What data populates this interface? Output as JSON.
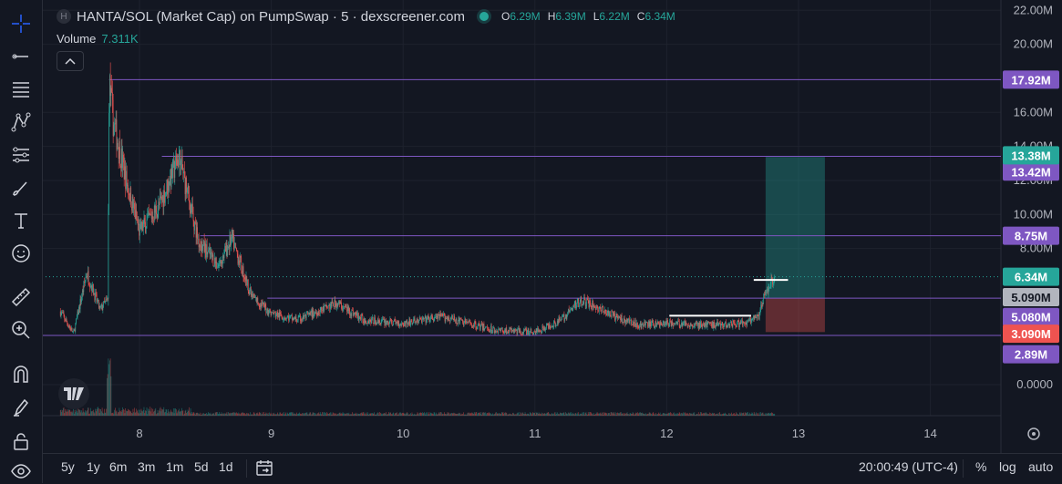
{
  "header": {
    "symbol_badge": "H",
    "title": "HANTA/SOL (Market Cap) on PumpSwap · 5 · dexscreener.com",
    "ohlc": [
      {
        "key": "O",
        "value": "6.29M"
      },
      {
        "key": "H",
        "value": "6.39M"
      },
      {
        "key": "L",
        "value": "6.22M"
      },
      {
        "key": "C",
        "value": "6.34M"
      }
    ]
  },
  "volume": {
    "label": "Volume",
    "value": "7.311K"
  },
  "toolbar": {
    "icons": [
      "crosshair-icon",
      "trend-line-icon",
      "fib-levels-icon",
      "pattern-icon",
      "projection-icon",
      "brush-icon",
      "text-icon",
      "emoji-icon",
      "ruler-icon",
      "zoom-in-icon",
      "magnet-icon",
      "lock-pencil-icon",
      "lock-icon",
      "eye-icon"
    ]
  },
  "bottom": {
    "ranges": [
      "5y",
      "1y",
      "6m",
      "3m",
      "1m",
      "5d",
      "1d"
    ],
    "time": "20:00:49 (UTC-4)",
    "percent": "%",
    "log": "log",
    "auto": "auto"
  },
  "colors": {
    "background": "#131722",
    "up": "#26a69a",
    "down": "#ef5350",
    "line": "#7e57c2",
    "level_label": "#7e57c2",
    "current_price": "#26a69a"
  },
  "chart_data": {
    "type": "candlestick",
    "title": "HANTA/SOL (Market Cap) on PumpSwap · 5 · dexscreener.com",
    "y_axis_ticks": [
      "22.00M",
      "20.00M",
      "16.00M",
      "14.00M",
      "12.00M",
      "10.00M",
      "8.00M",
      "0.0000"
    ],
    "y_tick_values": [
      22,
      20,
      16,
      14,
      12,
      10,
      8,
      0
    ],
    "x_axis_ticks": [
      "8",
      "9",
      "10",
      "11",
      "12",
      "13",
      "14"
    ],
    "x_tick_values": [
      8,
      9,
      10,
      11,
      12,
      13,
      14
    ],
    "price_path": [
      [
        7.4,
        4.3
      ],
      [
        7.5,
        3.0
      ],
      [
        7.6,
        6.6
      ],
      [
        7.7,
        4.4
      ],
      [
        7.76,
        5.0
      ],
      [
        7.77,
        17.9
      ],
      [
        7.8,
        15.5
      ],
      [
        7.9,
        12.0
      ],
      [
        8.0,
        9.0
      ],
      [
        8.15,
        10.5
      ],
      [
        8.3,
        13.4
      ],
      [
        8.45,
        8.4
      ],
      [
        8.6,
        7.0
      ],
      [
        8.7,
        8.6
      ],
      [
        8.85,
        5.2
      ],
      [
        9.0,
        4.2
      ],
      [
        9.2,
        3.8
      ],
      [
        9.5,
        4.8
      ],
      [
        9.7,
        3.8
      ],
      [
        10.0,
        3.6
      ],
      [
        10.3,
        4.0
      ],
      [
        10.7,
        3.2
      ],
      [
        11.0,
        3.1
      ],
      [
        11.2,
        3.8
      ],
      [
        11.35,
        5.0
      ],
      [
        11.6,
        4.0
      ],
      [
        11.8,
        3.5
      ],
      [
        12.0,
        3.6
      ],
      [
        12.3,
        3.5
      ],
      [
        12.6,
        3.6
      ],
      [
        12.7,
        4.0
      ],
      [
        12.75,
        5.5
      ],
      [
        12.82,
        6.34
      ]
    ],
    "volume_spike_x": 7.77,
    "levels": [
      {
        "label": "17.92M",
        "value": 17.92,
        "x_start": 7.77
      },
      {
        "label": "13.42M",
        "value": 13.42,
        "x_start": 8.17
      },
      {
        "label": "8.75M",
        "value": 8.75,
        "x_start": 8.46
      },
      {
        "label": "5.080M",
        "value": 5.08,
        "x_start": 8.97
      },
      {
        "label": "2.89M",
        "value": 2.89,
        "x_start": 7.0
      }
    ],
    "position": {
      "entry": 5.09,
      "target": 13.38,
      "stop": 3.09,
      "entry_label": "5.090M",
      "target_label": "13.38M",
      "stop_label": "3.090M",
      "x_start": 12.75,
      "x_end": 13.2
    },
    "current_price": {
      "value": 6.34,
      "label": "6.34M"
    },
    "white_segments": [
      {
        "x1": 12.02,
        "x2": 12.64,
        "value": 4.05
      },
      {
        "x1": 12.66,
        "x2": 12.92,
        "value": 6.15
      }
    ]
  }
}
